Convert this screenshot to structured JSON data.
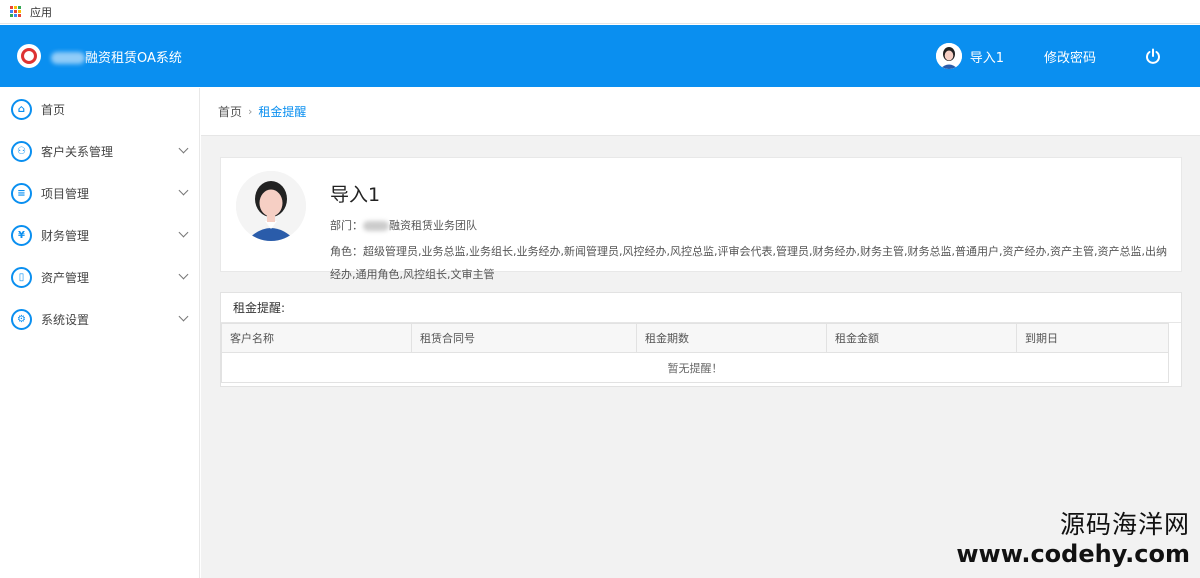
{
  "bookmarks": {
    "apps_label": "应用"
  },
  "header": {
    "title_suffix": "融资租赁OA系统",
    "user_name": "导入1",
    "change_password": "修改密码"
  },
  "sidebar": {
    "items": [
      {
        "label": "首页",
        "icon": "home-icon",
        "glyph": "⌂",
        "expandable": false
      },
      {
        "label": "客户关系管理",
        "icon": "users-icon",
        "glyph": "⚇",
        "expandable": true
      },
      {
        "label": "项目管理",
        "icon": "list-icon",
        "glyph": "≡",
        "expandable": true
      },
      {
        "label": "财务管理",
        "icon": "yen-icon",
        "glyph": "¥",
        "expandable": true
      },
      {
        "label": "资产管理",
        "icon": "document-icon",
        "glyph": "▯",
        "expandable": true
      },
      {
        "label": "系统设置",
        "icon": "gear-icon",
        "glyph": "⚙",
        "expandable": true
      }
    ]
  },
  "breadcrumb": {
    "home": "首页",
    "separator": "›",
    "current": "租金提醒"
  },
  "profile": {
    "name": "导入1",
    "dept_label": "部门：",
    "dept_value": "融资租赁业务团队",
    "roles": "角色：超级管理员,业务总监,业务组长,业务经办,新闻管理员,风控经办,风控总监,评审会代表,管理员,财务经办,财务主管,财务总监,普通用户,资产经办,资产主管,资产总监,出纳经办,通用角色,风控组长,文审主管"
  },
  "rent_panel": {
    "title": "租金提醒:",
    "columns": [
      "客户名称",
      "租赁合同号",
      "租金期数",
      "租金金额",
      "到期日"
    ],
    "empty_text": "暂无提醒！"
  },
  "watermark": {
    "cn": "源码海洋网",
    "url": "www.codehy.com"
  },
  "colors": {
    "accent": "#0a8ff0",
    "background": "#f2f2f2"
  }
}
